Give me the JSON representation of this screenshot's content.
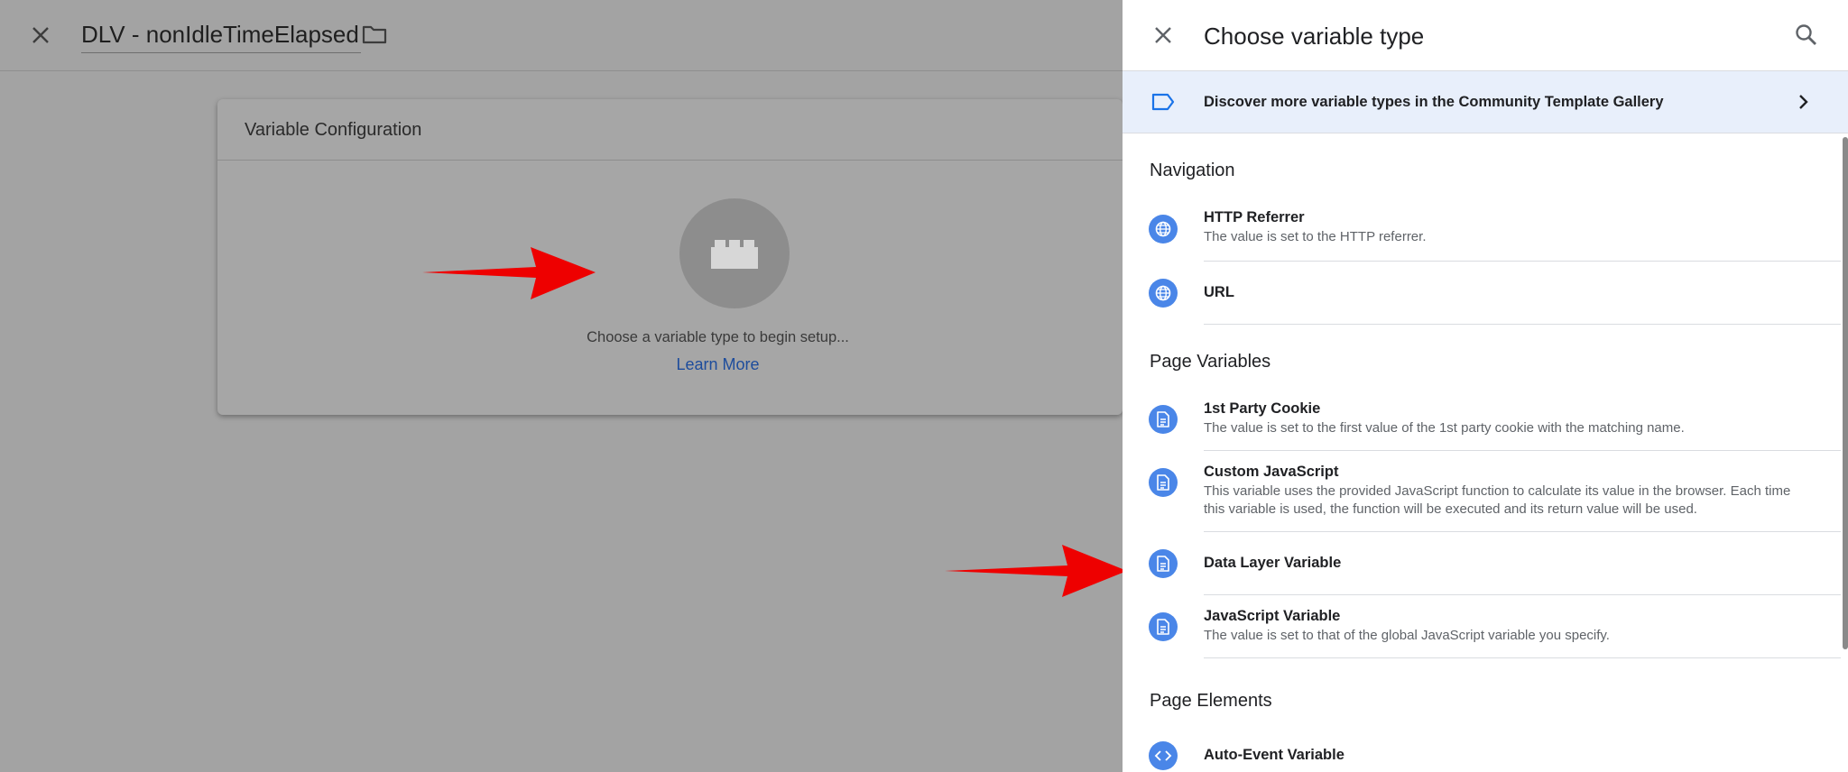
{
  "editor": {
    "title": "DLV - nonIdleTimeElapsed",
    "config_card": {
      "title": "Variable Configuration",
      "prompt": "Choose a variable type to begin setup...",
      "learn_more": "Learn More"
    }
  },
  "panel": {
    "title": "Choose variable type",
    "banner": "Discover more variable types in the Community Template Gallery",
    "sections": [
      {
        "title": "Navigation",
        "items": [
          {
            "name": "HTTP Referrer",
            "desc": "The value is set to the HTTP referrer.",
            "icon": "globe-icon"
          },
          {
            "name": "URL",
            "desc": "",
            "icon": "globe-icon"
          }
        ]
      },
      {
        "title": "Page Variables",
        "items": [
          {
            "name": "1st Party Cookie",
            "desc": "The value is set to the first value of the 1st party cookie with the matching name.",
            "icon": "document-icon"
          },
          {
            "name": "Custom JavaScript",
            "desc": "This variable uses the provided JavaScript function to calculate its value in the browser. Each time this variable is used, the function will be executed and its return value will be used.",
            "icon": "document-icon"
          },
          {
            "name": "Data Layer Variable",
            "desc": "",
            "icon": "document-icon"
          },
          {
            "name": "JavaScript Variable",
            "desc": "The value is set to that of the global JavaScript variable you specify.",
            "icon": "document-icon"
          }
        ]
      },
      {
        "title": "Page Elements",
        "items": [
          {
            "name": "Auto-Event Variable",
            "desc": "",
            "icon": "code-brackets-icon"
          }
        ]
      }
    ]
  },
  "colors": {
    "overlay_gray": "#a3a3a3",
    "accent_blue": "#4a86e8",
    "banner_bg": "#e8effb",
    "arrow_red": "#ee0000",
    "link_blue": "#1d4c9c"
  }
}
